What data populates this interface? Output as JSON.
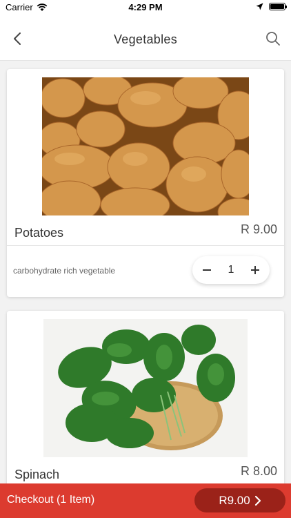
{
  "status_bar": {
    "carrier": "Carrier",
    "time": "4:29 PM"
  },
  "nav": {
    "title": "Vegetables"
  },
  "products": [
    {
      "name": "Potatoes",
      "price": "R 9.00",
      "description": "carbohydrate rich vegetable",
      "quantity": "1"
    },
    {
      "name": "Spinach",
      "price": "R 8.00"
    }
  ],
  "checkout": {
    "label": "Checkout (1 Item)",
    "total": "R9.00"
  },
  "colors": {
    "accent": "#dc3b2f",
    "accent_dark": "#9b2219"
  }
}
